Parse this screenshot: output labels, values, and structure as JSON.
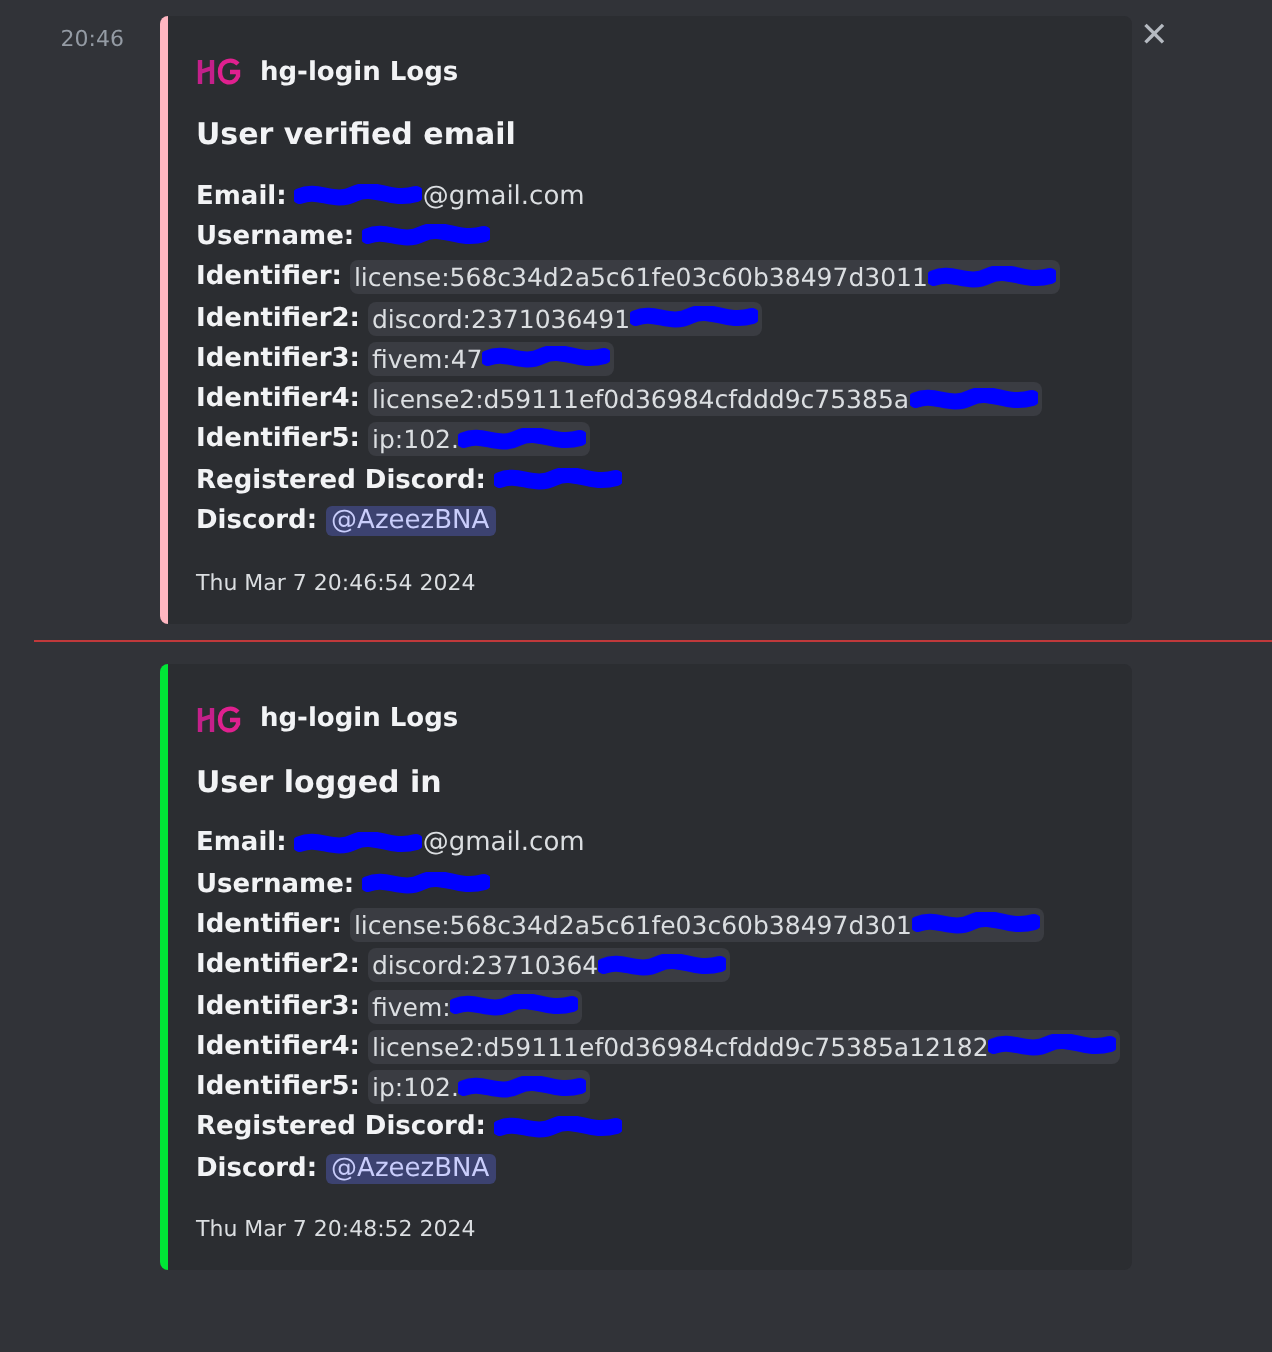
{
  "messages": [
    {
      "time": "20:46",
      "color": "#ffb6c1",
      "author": "hg-login Logs",
      "title": "User verified email",
      "footer": "Thu Mar  7 20:46:54 2024",
      "fields": [
        {
          "label": "Email:",
          "kind": "text",
          "value": "@gmail.com",
          "redacted_before": true
        },
        {
          "label": "Username:",
          "kind": "text",
          "redacted_after": true
        },
        {
          "label": "Identifier:",
          "kind": "code",
          "value": "license:568c34d2a5c61fe03c60b38497d3011",
          "redacted_after": true
        },
        {
          "label": "Identifier2:",
          "kind": "code",
          "value": "discord:2371036491",
          "redacted_after": true
        },
        {
          "label": "Identifier3:",
          "kind": "code",
          "value": "fivem:47",
          "redacted_after": true
        },
        {
          "label": "Identifier4:",
          "kind": "code",
          "value": "license2:d59111ef0d36984cfddd9c75385a",
          "redacted_after": true
        },
        {
          "label": "Identifier5:",
          "kind": "code",
          "value": "ip:102.",
          "redacted_after": true
        },
        {
          "label": "Registered Discord:",
          "kind": "text",
          "redacted_after": true
        },
        {
          "label": "Discord:",
          "kind": "mention",
          "value": "@AzeezBNA"
        }
      ]
    },
    {
      "color": "#00e636",
      "author": "hg-login Logs",
      "title": "User logged in",
      "footer": "Thu Mar  7 20:48:52 2024",
      "fields": [
        {
          "label": "Email:",
          "kind": "text",
          "value": "@gmail.com",
          "redacted_before": true
        },
        {
          "label": "Username:",
          "kind": "text",
          "redacted_after": true
        },
        {
          "label": "Identifier:",
          "kind": "code",
          "value": "license:568c34d2a5c61fe03c60b38497d301",
          "redacted_after": true
        },
        {
          "label": "Identifier2:",
          "kind": "code",
          "value": "discord:23710364",
          "redacted_after": true
        },
        {
          "label": "Identifier3:",
          "kind": "code",
          "value": "fivem:",
          "redacted_after": true
        },
        {
          "label": "Identifier4:",
          "kind": "code",
          "value": "license2:d59111ef0d36984cfddd9c75385a12182",
          "redacted_after": true
        },
        {
          "label": "Identifier5:",
          "kind": "code",
          "value": "ip:102.",
          "redacted_after": true
        },
        {
          "label": "Registered Discord:",
          "kind": "text",
          "redacted_after": true
        },
        {
          "label": "Discord:",
          "kind": "mention",
          "value": "@AzeezBNA"
        }
      ]
    }
  ],
  "close": "✕"
}
